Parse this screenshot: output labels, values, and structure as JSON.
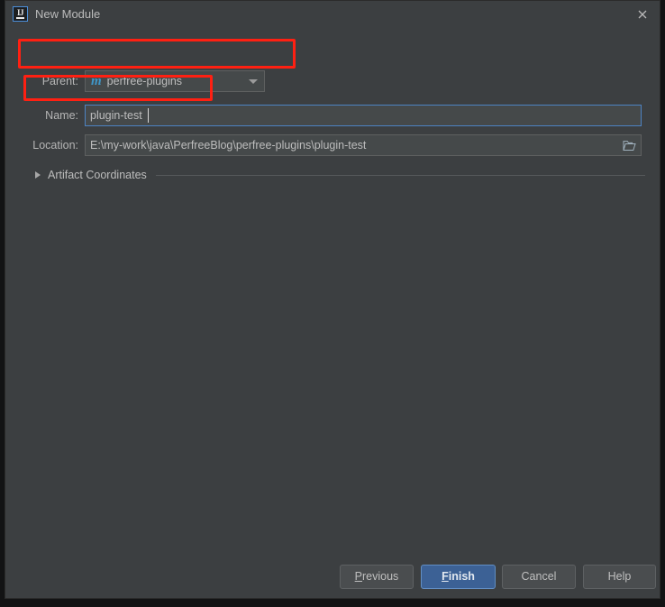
{
  "window": {
    "title": "New Module",
    "app_icon": "intellij-idea-icon",
    "close_icon": "close-icon"
  },
  "form": {
    "parent": {
      "label": "Parent:",
      "value": "perfree-plugins",
      "icon": "maven-module-icon",
      "dropdown_icon": "chevron-down-icon"
    },
    "name": {
      "label": "Name:",
      "value": "plugin-test",
      "placeholder": ""
    },
    "location": {
      "label": "Location:",
      "value": "E:\\my-work\\java\\PerfreeBlog\\perfree-plugins\\plugin-test",
      "browse_icon": "folder-icon"
    },
    "artifact_coordinates": {
      "label": "Artifact Coordinates",
      "expanded": false,
      "disclosure_icon": "triangle-right-icon"
    }
  },
  "footer": {
    "previous": "Previous",
    "finish": "Finish",
    "cancel": "Cancel",
    "help": "Help"
  },
  "annotations": {
    "highlight_color": "#ff2012",
    "boxes": [
      "parent-row-highlight",
      "name-row-highlight"
    ]
  },
  "colors": {
    "dialog_background": "#3c3f41",
    "field_background": "#45494a",
    "focus_border": "#4d83c3",
    "accent_button": "#3c6195",
    "maven_icon": "#3f97c9"
  }
}
